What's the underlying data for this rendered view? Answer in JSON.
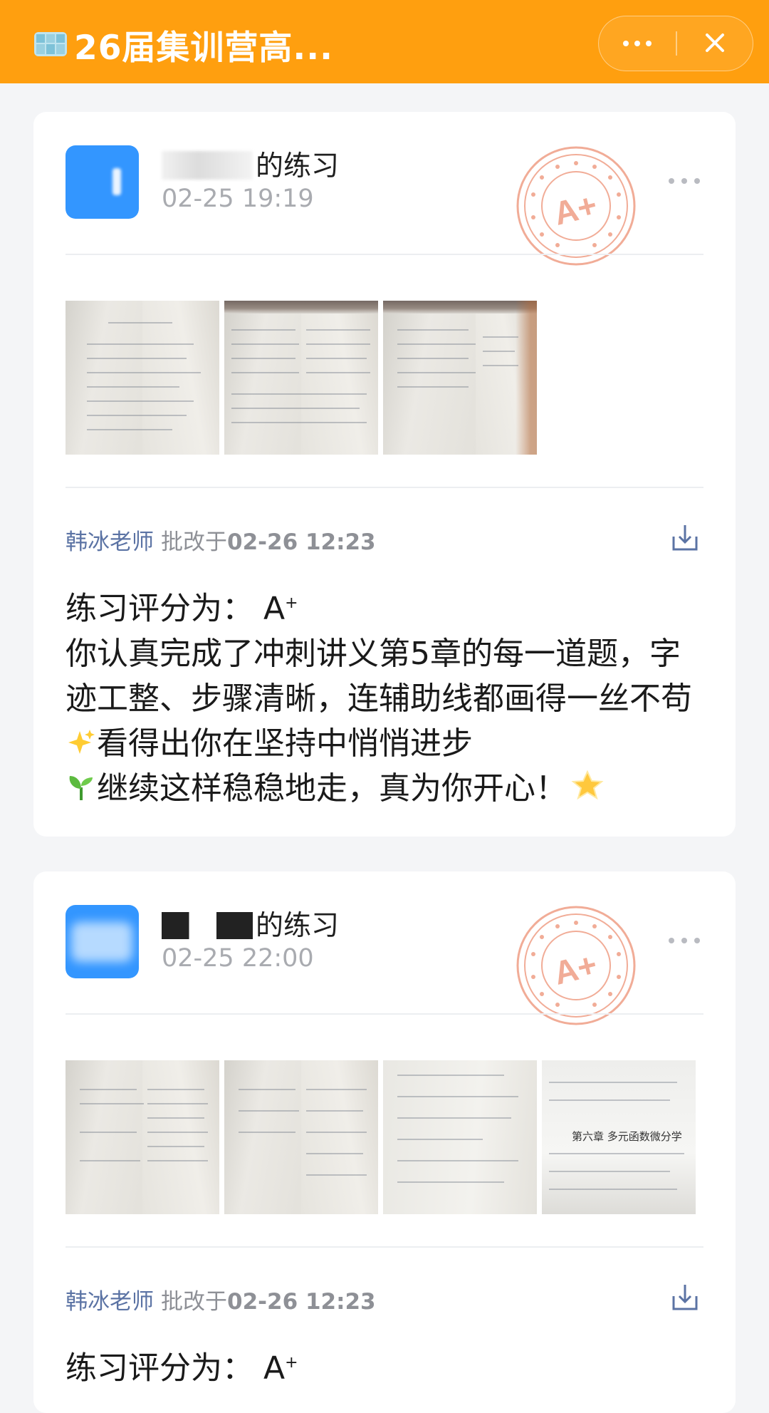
{
  "header": {
    "title": "26届集训营高...",
    "more_icon": "more-dots-icon",
    "close_icon": "close-icon",
    "background": "#ff9f0f"
  },
  "posts": [
    {
      "title_suffix": "的练习",
      "time": "02-25 19:19",
      "stamp_text": "A+",
      "review": {
        "teacher": "韩冰老师",
        "label": "批改于",
        "time": "02-26 12:23"
      },
      "comment": {
        "score_label": "练习评分为：",
        "score": "A",
        "score_sup": "+",
        "body_1": "你认真完成了冲刺讲义第5章的每一道题，字迹工整、步骤清晰，连辅助线都画得一丝不苟",
        "body_2": "看得出你在坚持中悄悄进步",
        "body_3": "继续这样稳稳地走，真为你开心！"
      }
    },
    {
      "title_suffix": "的练习",
      "time": "02-25 22:00",
      "stamp_text": "A+",
      "thumb4_chapter": "第六章  多元函数微分学",
      "review": {
        "teacher": "韩冰老师",
        "label": "批改于",
        "time": "02-26 12:23"
      },
      "comment": {
        "score_label": "练习评分为：",
        "score": "A",
        "score_sup": "+"
      }
    }
  ]
}
